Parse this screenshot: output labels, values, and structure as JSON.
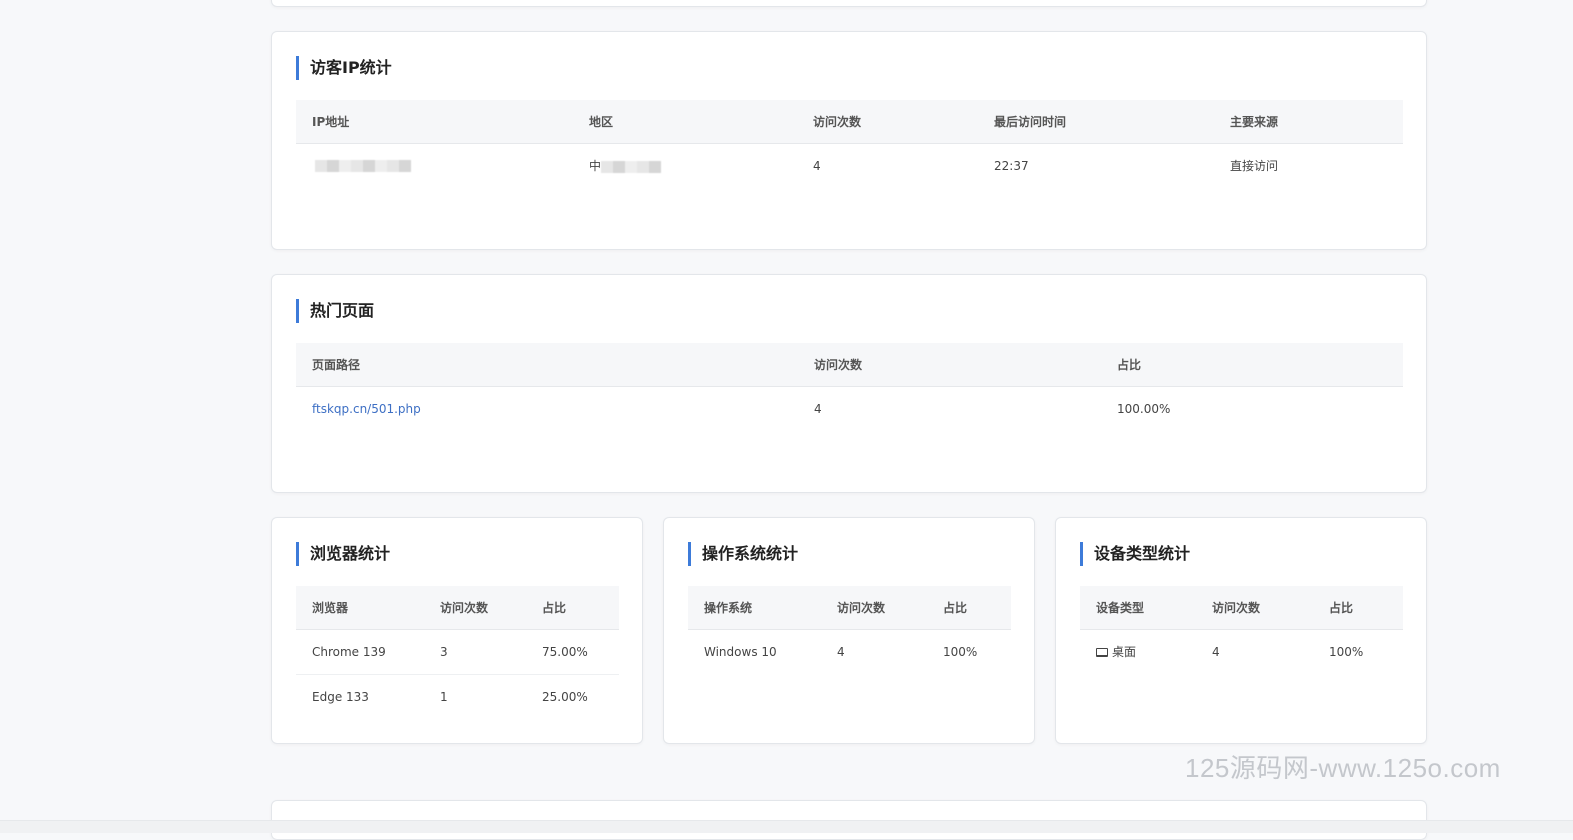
{
  "visitor_ip": {
    "title": "访客IP统计",
    "headers": [
      "IP地址",
      "地区",
      "访问次数",
      "最后访问时间",
      "主要来源"
    ],
    "rows": [
      {
        "region_prefix": "中",
        "visits": "4",
        "last_visit": "22:37",
        "source": "直接访问"
      }
    ]
  },
  "hot_pages": {
    "title": "热门页面",
    "headers": [
      "页面路径",
      "访问次数",
      "占比"
    ],
    "rows": [
      {
        "path": "ftskqp.cn/501.php",
        "visits": "4",
        "share": "100.00%"
      }
    ]
  },
  "browser": {
    "title": "浏览器统计",
    "headers": [
      "浏览器",
      "访问次数",
      "占比"
    ],
    "rows": [
      {
        "name": "Chrome 139",
        "visits": "3",
        "share": "75.00%"
      },
      {
        "name": "Edge 133",
        "visits": "1",
        "share": "25.00%"
      }
    ]
  },
  "os": {
    "title": "操作系统统计",
    "headers": [
      "操作系统",
      "访问次数",
      "占比"
    ],
    "rows": [
      {
        "name": "Windows 10",
        "visits": "4",
        "share": "100%"
      }
    ]
  },
  "device": {
    "title": "设备类型统计",
    "headers": [
      "设备类型",
      "访问次数",
      "占比"
    ],
    "rows": [
      {
        "name": "桌面",
        "icon": "desktop-icon",
        "visits": "4",
        "share": "100%"
      }
    ]
  },
  "watermark": "125源码网-www.125o.com",
  "colors": {
    "accent": "#3d7bd9",
    "link": "#3d6fc4",
    "page_bg": "#f7f8fa"
  }
}
